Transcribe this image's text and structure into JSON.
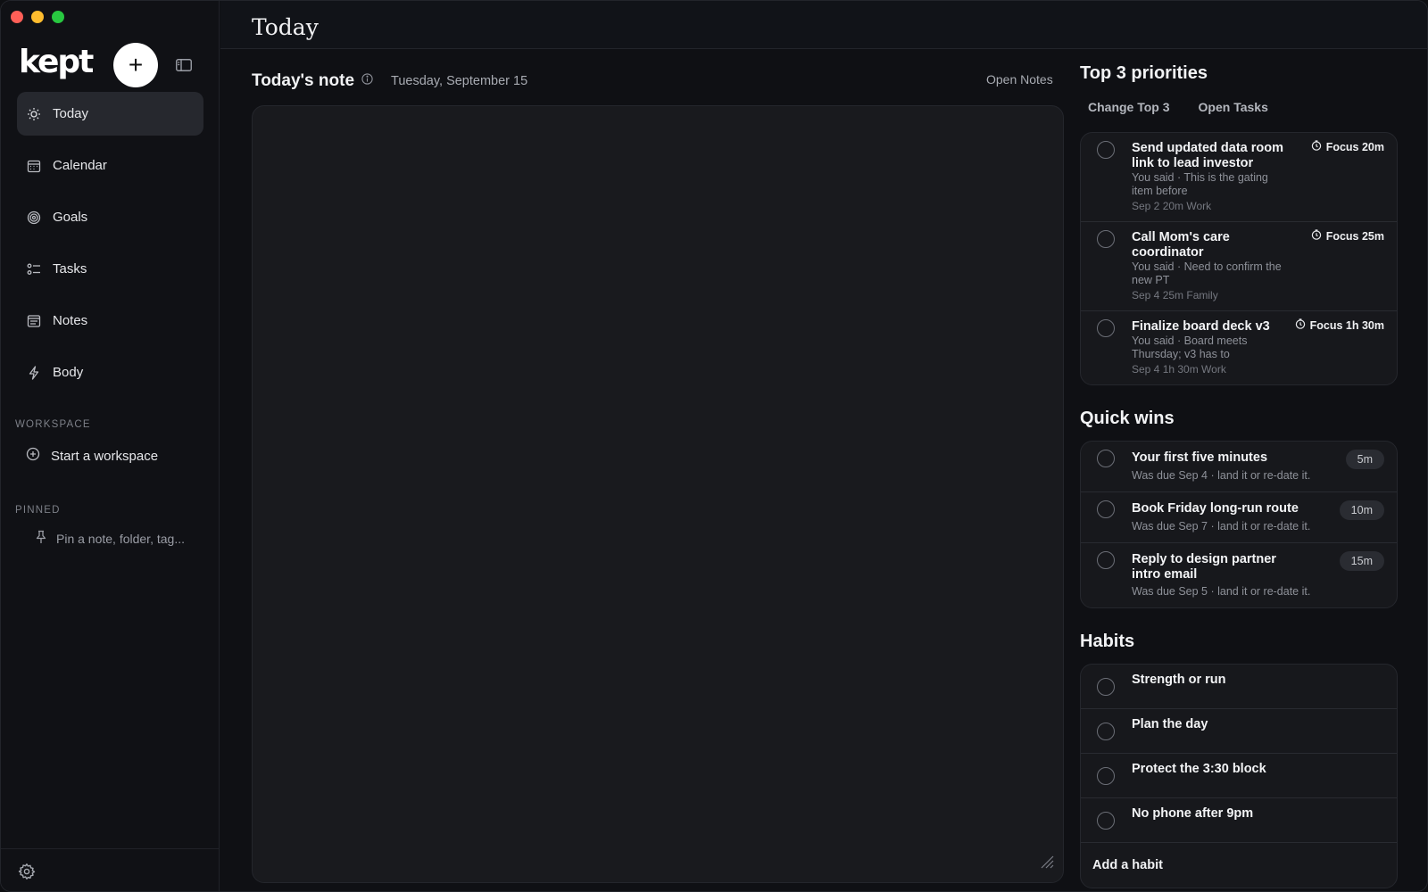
{
  "colors": {
    "traffic_red": "#ff5f57",
    "traffic_yellow": "#febc2e",
    "traffic_green": "#28c840",
    "accent": "#ffffff"
  },
  "sidebar": {
    "logo": "kept",
    "new_button_label": "+",
    "items": [
      {
        "label": "Today",
        "icon": "sun-icon",
        "active": true
      },
      {
        "label": "Calendar",
        "icon": "calendar-icon"
      },
      {
        "label": "Goals",
        "icon": "target-icon"
      },
      {
        "label": "Tasks",
        "icon": "checklist-icon"
      },
      {
        "label": "Notes",
        "icon": "note-icon"
      },
      {
        "label": "Body",
        "icon": "bolt-icon"
      }
    ],
    "workspace_label": "WORKSPACE",
    "workspace_action": "Start a workspace",
    "pinned_label": "PINNED",
    "pinned_placeholder": "Pin a note, folder, tag..."
  },
  "header": {
    "title": "Today"
  },
  "note": {
    "title": "Today's note",
    "date": "Tuesday, September 15",
    "open_notes": "Open Notes"
  },
  "priorities": {
    "title": "Top 3 priorities",
    "change_label": "Change Top 3",
    "open_tasks_label": "Open Tasks",
    "items": [
      {
        "title_line1": "Send updated data room",
        "title_line2": "link to lead investor",
        "sub_line1": "You said · This is the gating",
        "sub_line2": "item before",
        "meta": "Sep 2  20m  Work",
        "focus": "Focus 20m"
      },
      {
        "title_line1": "Call Mom's care",
        "title_line2": "coordinator",
        "sub_line1": "You said · Need to confirm the",
        "sub_line2": "new PT",
        "meta": "Sep 4  25m  Family",
        "focus": "Focus 25m"
      },
      {
        "title_line1": "Finalize board deck v3",
        "sub_line1": "You said · Board meets",
        "sub_line2": "Thursday; v3 has to",
        "meta": "Sep 4  1h 30m  Work",
        "focus": "Focus 1h 30m"
      }
    ]
  },
  "quick_wins": {
    "title": "Quick wins",
    "items": [
      {
        "title_line1": "Your first five minutes",
        "sub": "Was due Sep 4 · land it or re-date it.",
        "duration": "5m"
      },
      {
        "title_line1": "Book Friday long-run route",
        "sub": "Was due Sep 7 · land it or re-date it.",
        "duration": "10m"
      },
      {
        "title_line1": "Reply to design partner",
        "title_line2": "intro email",
        "sub": "Was due Sep 5 · land it or re-date it.",
        "duration": "15m"
      }
    ]
  },
  "habits": {
    "title": "Habits",
    "items": [
      "Strength or run",
      "Plan the day",
      "Protect the 3:30 block",
      "No phone after 9pm"
    ],
    "add_label": "Add a habit"
  }
}
